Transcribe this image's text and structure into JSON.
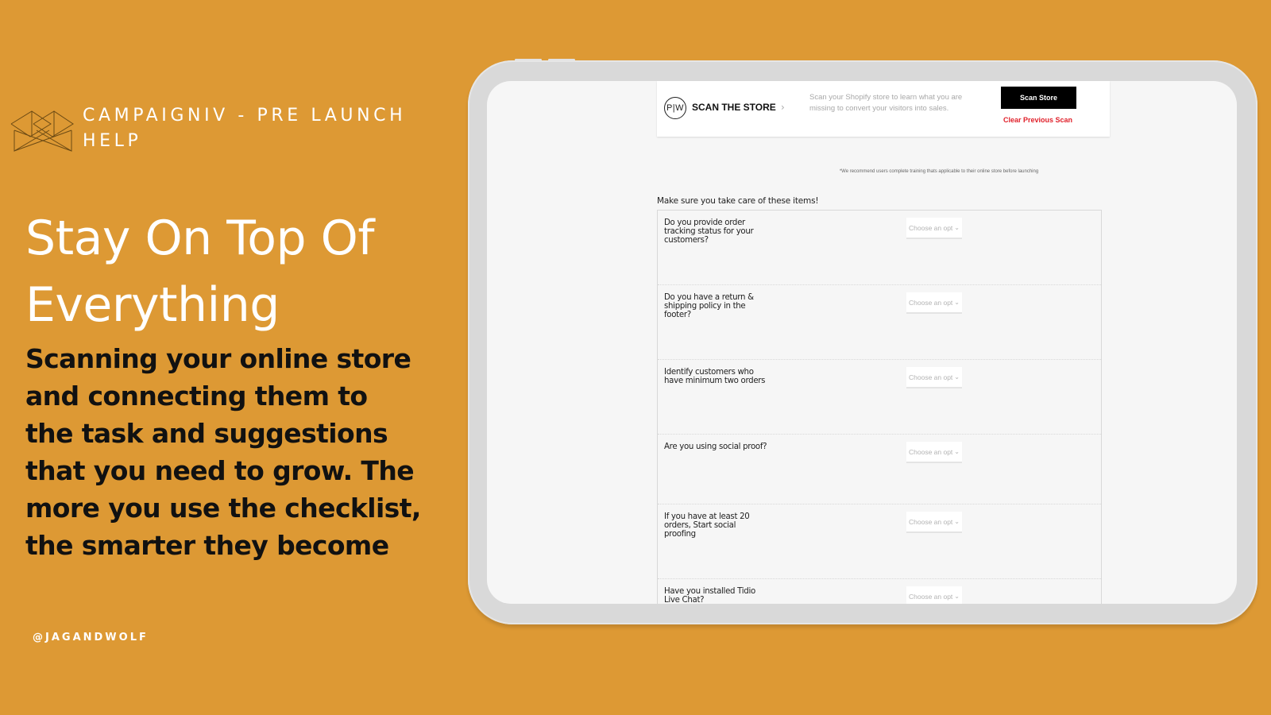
{
  "brand": {
    "logo_icon": "geometric-box-logo",
    "title": "CAMPAIGNIV - PRE LAUNCH HELP"
  },
  "headline": "Stay On Top Of Everything",
  "description": "Scanning your online store and connecting them to the task and suggestions that you need to grow. The more you use the checklist, the smarter they become",
  "handle": "@JAGANDWOLF",
  "colors": {
    "background": "#DD9934",
    "scan_button": "#000000",
    "clear_link": "#E0202A"
  },
  "app": {
    "scan_card": {
      "logo_text": "P|W",
      "title": "SCAN THE STORE",
      "chevron": "›",
      "description": "Scan your Shopify store to learn what you are missing to convert your visitors into sales.",
      "scan_button": "Scan Store",
      "clear_link": "Clear Previous Scan"
    },
    "recommend_note": "*We recommend users complete training thats applicable to their online store before launching",
    "checklist_heading": "Make sure you take care of these items!",
    "select_placeholder": "Choose an opt",
    "items": [
      {
        "question": "Do you provide order tracking status for your customers?"
      },
      {
        "question": "Do you have a return & shipping policy in the footer?"
      },
      {
        "question": "Identify customers who have minimum two orders"
      },
      {
        "question": "Are you using social proof?"
      },
      {
        "question": "If you have at least 20 orders, Start social proofing"
      },
      {
        "question": "Have you installed Tidio Live Chat?"
      }
    ]
  }
}
